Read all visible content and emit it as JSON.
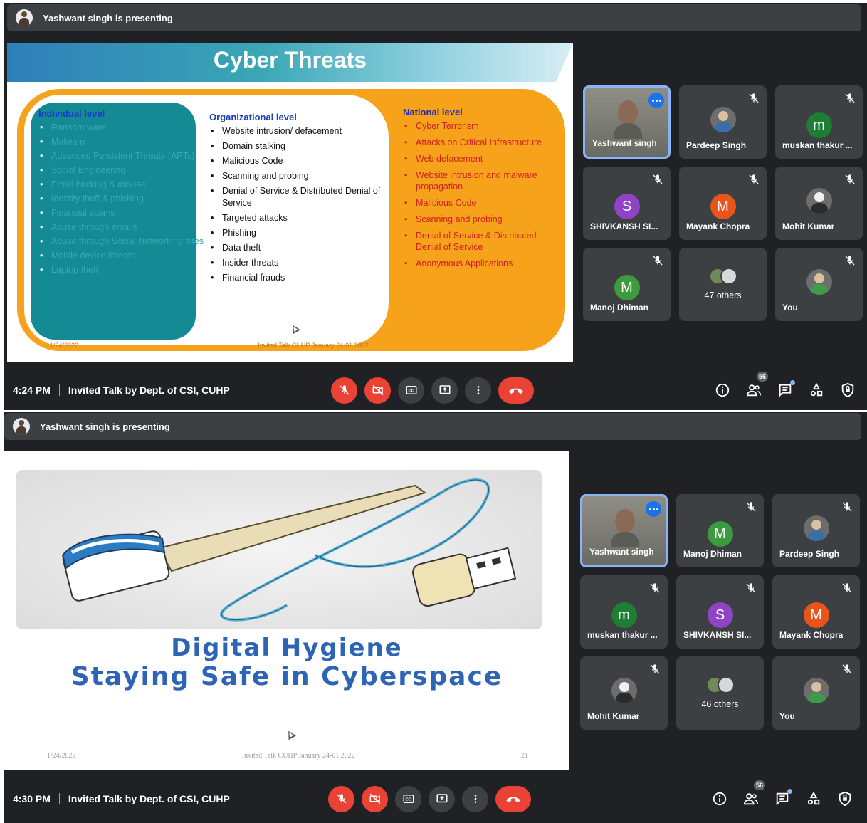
{
  "colors": {
    "background": "#202124",
    "surface": "#3c4043",
    "danger": "#ea4335",
    "accent": "#1a73e8",
    "speaking_border": "#8ab4f8"
  },
  "top": {
    "presenting_text": "Yashwant singh is presenting",
    "slide": {
      "title": "Cyber Threats",
      "columns": [
        {
          "heading": "Individual level",
          "items": [
            "Ransom ware",
            "Malware",
            "Advanced Persistent Threats (APTs)",
            "Social Engineering",
            "Email hacking & misuse",
            "Identity theft & phishing",
            "Financial scams",
            "Abuse through emails",
            "Abuse through Social Networking sites",
            "Mobile device threats",
            "Laptop theft"
          ]
        },
        {
          "heading": "Organizational level",
          "items": [
            "Website intrusion/ defacement",
            "Domain stalking",
            "Malicious Code",
            "Scanning and probing",
            "Denial of Service & Distributed Denial of Service",
            "Targeted attacks",
            "Phishing",
            "Data theft",
            "Insider threats",
            "Financial frauds"
          ]
        },
        {
          "heading": "National level",
          "items": [
            "Cyber Terrorism",
            "Attacks on Critical Infrastructure",
            "Web defacement",
            "Website intrusion and malware propagation",
            "Malicious Code",
            "Scanning and probing",
            "Denial of Service & Distributed Denial of Service",
            "Anonymous Applications"
          ]
        }
      ],
      "footer_left": "1/24/2022",
      "footer_center": "Invited Talk CUHP January 24-01 2022",
      "footer_right": ""
    },
    "tiles": [
      {
        "name": "Yashwant singh",
        "type": "video",
        "speaking": true,
        "icon": "more-options-icon"
      },
      {
        "name": "Pardeep Singh",
        "type": "photo",
        "photo": "default",
        "icon": "mic-off-icon"
      },
      {
        "name": "muskan thakur ...",
        "type": "letter",
        "letter": "m",
        "color": "#1e7e34",
        "icon": "mic-off-icon"
      },
      {
        "name": "SHIVKANSH SI...",
        "type": "letter",
        "letter": "S",
        "color": "#8e44c4",
        "icon": "mic-off-icon"
      },
      {
        "name": "Mayank Chopra",
        "type": "letter",
        "letter": "M",
        "color": "#e8541c",
        "icon": "mic-off-icon"
      },
      {
        "name": "Mohit Kumar",
        "type": "photo",
        "photo": "gray",
        "icon": "mic-off-icon"
      },
      {
        "name": "Manoj Dhiman",
        "type": "letter",
        "letter": "M",
        "color": "#3b9b3e",
        "icon": "mic-off-icon"
      },
      {
        "name": "47 others",
        "type": "others"
      },
      {
        "name": "You",
        "type": "photo",
        "photo": "green",
        "icon": "mic-off-icon"
      }
    ],
    "time": "4:24 PM",
    "meeting_title": "Invited Talk by Dept. of CSI, CUHP",
    "participant_count": "56"
  },
  "bottom": {
    "presenting_text": "Yashwant singh is presenting",
    "slide": {
      "title_line1": "Digital Hygiene",
      "title_line2": "Staying Safe in Cyberspace",
      "footer_left": "1/24/2022",
      "footer_center": "Invited Talk CUHP January 24-01 2022",
      "footer_right": "21"
    },
    "tiles": [
      {
        "name": "Yashwant singh",
        "type": "video",
        "speaking": true,
        "icon": "more-options-icon"
      },
      {
        "name": "Manoj Dhiman",
        "type": "letter",
        "letter": "M",
        "color": "#3b9b3e",
        "icon": "mic-off-icon"
      },
      {
        "name": "Pardeep Singh",
        "type": "photo",
        "photo": "default",
        "icon": "mic-off-icon"
      },
      {
        "name": "muskan thakur ...",
        "type": "letter",
        "letter": "m",
        "color": "#1e7e34",
        "icon": "mic-off-icon"
      },
      {
        "name": "SHIVKANSH SI...",
        "type": "letter",
        "letter": "S",
        "color": "#8e44c4",
        "icon": "mic-off-icon"
      },
      {
        "name": "Mayank Chopra",
        "type": "letter",
        "letter": "M",
        "color": "#e8541c",
        "icon": "mic-off-icon"
      },
      {
        "name": "Mohit Kumar",
        "type": "photo",
        "photo": "gray",
        "icon": "mic-off-icon"
      },
      {
        "name": "46 others",
        "type": "others"
      },
      {
        "name": "You",
        "type": "photo",
        "photo": "green",
        "icon": "mic-off-icon"
      }
    ],
    "time": "4:30 PM",
    "meeting_title": "Invited Talk by Dept. of CSI, CUHP",
    "participant_count": "56"
  },
  "controls": [
    {
      "icon": "mic-off-icon",
      "style": "red"
    },
    {
      "icon": "camera-off-icon",
      "style": "red"
    },
    {
      "icon": "captions-icon",
      "style": "dark"
    },
    {
      "icon": "present-screen-icon",
      "style": "dark"
    },
    {
      "icon": "more-options-icon",
      "style": "dark"
    },
    {
      "icon": "end-call-icon",
      "style": "end"
    }
  ],
  "right_icons": [
    "info-icon",
    "people-icon",
    "chat-icon",
    "activities-icon",
    "host-controls-icon"
  ]
}
